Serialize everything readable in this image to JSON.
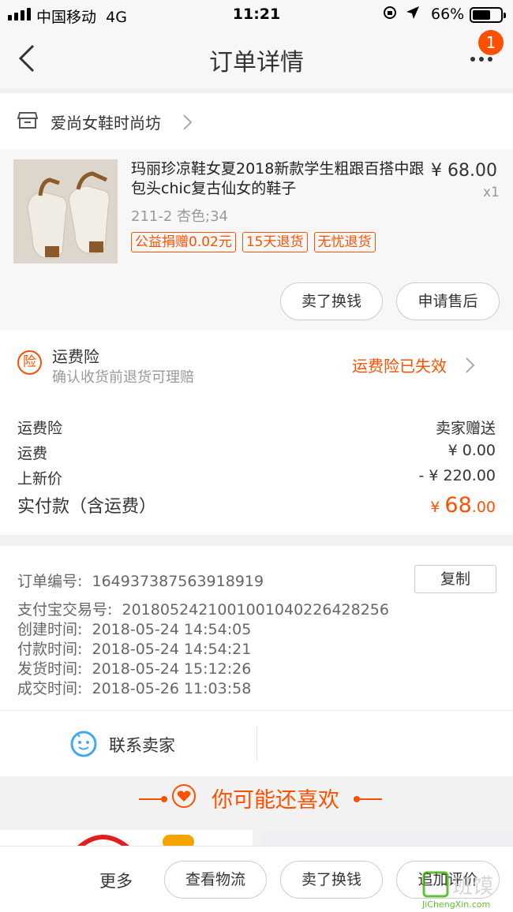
{
  "status_bar": {
    "carrier": "中国移动",
    "network": "4G",
    "time": "11:21",
    "battery_pct": "66%",
    "battery_level": 0.66
  },
  "nav": {
    "title": "订单详情",
    "badge_count": "1"
  },
  "shop": {
    "name": "爱尚女鞋时尚坊"
  },
  "product": {
    "title": "玛丽珍凉鞋女夏2018新款学生粗跟百搭中跟包头chic复古仙女的鞋子",
    "price": "¥ 68.00",
    "qty": "x1",
    "sku": "211-2 杏色;34",
    "tags": [
      "公益捐赠0.02元",
      "15天退货",
      "无忧退货"
    ],
    "actions": [
      "卖了换钱",
      "申请售后"
    ]
  },
  "insurance": {
    "icon_char": "险",
    "title": "运费险",
    "subtitle": "确认收货前退货可理赔",
    "status": "运费险已失效"
  },
  "costs": [
    {
      "label": "运费险",
      "value": "卖家赠送"
    },
    {
      "label": "运费",
      "value": "¥ 0.00"
    },
    {
      "label": "上新价",
      "value": "- ¥ 220.00"
    }
  ],
  "paid": {
    "label": "实付款（含运费）",
    "yen": "¥ ",
    "int": "68",
    "dec": ".00"
  },
  "order_info": {
    "order_no_label": "订单编号:",
    "order_no": "164937387563918919",
    "copy_label": "复制",
    "lines": [
      {
        "label": "支付宝交易号:",
        "value": "2018052421001001040226428256"
      },
      {
        "label": "创建时间:",
        "value": "2018-05-24 14:54:05"
      },
      {
        "label": "付款时间:",
        "value": "2018-05-24 14:54:21"
      },
      {
        "label": "发货时间:",
        "value": "2018-05-24 15:12:26"
      },
      {
        "label": "成交时间:",
        "value": "2018-05-26 11:03:58"
      }
    ]
  },
  "contact": {
    "label": "联系卖家"
  },
  "recommend": {
    "title": "你可能还喜欢"
  },
  "bottom_bar": {
    "more": "更多",
    "buttons": [
      "查看物流",
      "卖了换钱",
      "追加评价"
    ]
  },
  "watermark": {
    "text": "JiChengXin.com"
  },
  "colors": {
    "accent": "#ff5000",
    "contact_icon": "#3fa9f5"
  }
}
